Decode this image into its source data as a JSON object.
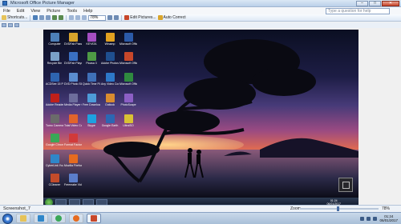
{
  "window": {
    "title": "Microsoft Office Picture Manager",
    "minimize": "–",
    "maximize": "□",
    "close": "✕"
  },
  "menu": [
    "File",
    "Edit",
    "View",
    "Picture",
    "Tools",
    "Help"
  ],
  "help_search": {
    "placeholder": "Type a question for help"
  },
  "toolbar": {
    "shortcuts": "Shortcuts...",
    "zoom": "78%",
    "edit_pictures": "Edit Pictures...",
    "auto_correct": "Auto Correct"
  },
  "desktop_icons": [
    {
      "label": "Computer",
      "color": "#4d7fb8"
    },
    {
      "label": "Recycle Bin",
      "color": "#7aa0c8"
    },
    {
      "label": "ACDSee 15 Photo M...",
      "color": "#2e64b0"
    },
    {
      "label": "Adobe Reader X",
      "color": "#c0201a"
    },
    {
      "label": "Tumo Camera Screenshot...",
      "color": "#6b6b6b"
    },
    {
      "label": "Google Chrome",
      "color": "#3aa757"
    },
    {
      "label": "CyberLink YouCam",
      "color": "#2f86c9"
    },
    {
      "label": "CCleaner",
      "color": "#c24b2a"
    },
    {
      "label": "DVDFab Passkey",
      "color": "#d7a32c"
    },
    {
      "label": "DVDFab Player",
      "color": "#3a6fc2"
    },
    {
      "label": "DVD Photo Slideshow",
      "color": "#5a8ccf"
    },
    {
      "label": "Media Player Classic",
      "color": "#6d6d9c"
    },
    {
      "label": "Total Video Converter",
      "color": "#e2642b"
    },
    {
      "label": "Format Factory",
      "color": "#d13a3a"
    },
    {
      "label": "Mozilla Firefox",
      "color": "#e66b1f"
    },
    {
      "label": "Freemake Video Conv...",
      "color": "#5b7ecb"
    },
    {
      "label": "KEYATA",
      "color": "#a44ec2"
    },
    {
      "label": "Picasa 3",
      "color": "#4e9a45"
    },
    {
      "label": "Quick Time Player",
      "color": "#3f70b8"
    },
    {
      "label": "Free Downloader",
      "color": "#4d9bd8"
    },
    {
      "label": "Skype",
      "color": "#1ea1e0"
    },
    {
      "label": "Winamp",
      "color": "#e0a020"
    },
    {
      "label": "Adobe Photosh...",
      "color": "#1f4f8f"
    },
    {
      "label": "Any Video Converter",
      "color": "#2d78c8"
    },
    {
      "label": "Outlook",
      "color": "#d98c2f"
    },
    {
      "label": "Google Earth",
      "color": "#2c67b3"
    },
    {
      "label": "Microsoft Office Wo...",
      "color": "#2b5aa8"
    },
    {
      "label": "Microsoft Office Po...",
      "color": "#c7472a"
    },
    {
      "label": "Microsoft Office Ex...",
      "color": "#2f8a3f"
    },
    {
      "label": "PhotoScape",
      "color": "#8c5fc4"
    },
    {
      "label": "UltraISO",
      "color": "#d9c234"
    }
  ],
  "inner_taskbar": {
    "time": "01:24",
    "date": "06/01/2017"
  },
  "status": {
    "file_name": "Screenshot_7",
    "zoom_label": "Zoom",
    "zoom_percent": "78%"
  },
  "taskbar_apps": [
    {
      "name": "explorer",
      "color": "#e6c35a"
    },
    {
      "name": "media",
      "color": "#2f86c9"
    },
    {
      "name": "chrome",
      "color": "#3aa757"
    },
    {
      "name": "firefox",
      "color": "#e66b1f"
    },
    {
      "name": "picture-manager",
      "color": "#c7472a"
    }
  ],
  "os_clock": {
    "time": "01:24",
    "date": "06/01/2017"
  }
}
